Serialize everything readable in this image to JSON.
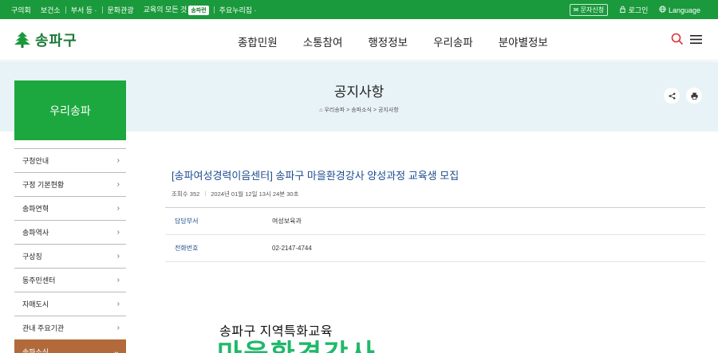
{
  "utilbar": {
    "links": [
      "구의회",
      "보건소",
      "부서 등 ·",
      "문화관광",
      "교육의 모든 것"
    ],
    "pill": "송파런",
    "more": "주요누리집 ·",
    "sms_label": "문자신청",
    "login_label": "로그인",
    "language_label": "Language"
  },
  "header": {
    "logo_text": "송파구",
    "nav": [
      "종합민원",
      "소통참여",
      "행정정보",
      "우리송파",
      "분야별정보"
    ]
  },
  "banner": {
    "title": "공지사항",
    "breadcrumb": "우리송파 > 송파소식 > 공지사항"
  },
  "sidebar": {
    "title": "우리송파",
    "items": [
      {
        "label": "구청안내",
        "icon": "chevron-right-icon"
      },
      {
        "label": "구정 기본현황",
        "icon": "chevron-right-icon"
      },
      {
        "label": "송파연혁",
        "icon": "chevron-right-icon"
      },
      {
        "label": "송파역사",
        "icon": "chevron-right-icon"
      },
      {
        "label": "구상징",
        "icon": "chevron-right-icon"
      },
      {
        "label": "동주민센터",
        "icon": "chevron-right-icon"
      },
      {
        "label": "자매도시",
        "icon": "chevron-right-icon"
      },
      {
        "label": "관내 주요기관",
        "icon": "chevron-right-icon"
      },
      {
        "label": "송파소식",
        "icon": "chevron-down-icon"
      }
    ]
  },
  "post": {
    "title": "[송파여성경력이음센터] 송파구 마을환경강사 양성과정 교육생 모집",
    "views": "조회수 352",
    "datetime": "2024년 01월 12일 13시 24분 30초",
    "rows": [
      {
        "label": "담당부서",
        "value": "여성보육과"
      },
      {
        "label": "전화번호",
        "value": "02-2147-4744"
      }
    ]
  },
  "poster": {
    "subtitle": "송파구 지역특화교육",
    "headline": "마을환경강사"
  },
  "colors": {
    "brand_green": "#1a9a3c",
    "sidebar_title_bg": "#1ca83e",
    "active_item_bg": "#b26a3b",
    "banner_bg": "#e8f3f8",
    "link_blue": "#1d4c8f"
  }
}
